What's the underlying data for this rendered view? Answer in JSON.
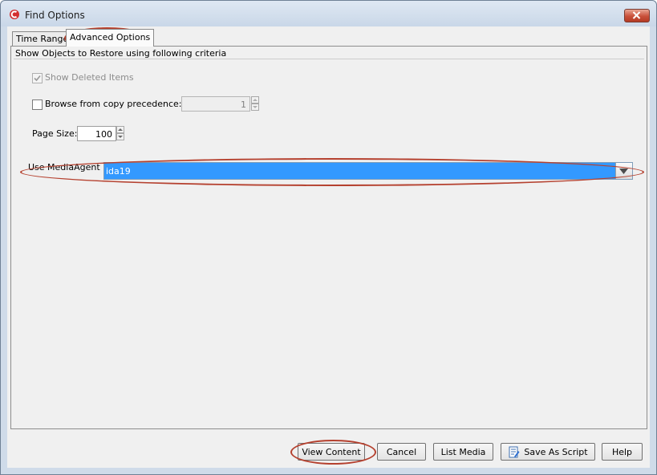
{
  "window": {
    "title": "Find Options",
    "app_icon": "commvault-logo-icon",
    "close_icon": "close-icon"
  },
  "tabs": [
    {
      "label": "Time Range",
      "selected": false
    },
    {
      "label": "Advanced Options",
      "selected": true
    }
  ],
  "criteria_group": {
    "title": "Show Objects to Restore using following criteria",
    "show_deleted": {
      "label": "Show Deleted Items",
      "checked": true,
      "enabled": false
    },
    "browse_copy": {
      "label": "Browse from copy precedence:",
      "checked": false,
      "value": "1",
      "enabled": false
    },
    "page_size": {
      "label": "Page Size:",
      "value": "100"
    },
    "media_agent": {
      "label": "Use MediaAgent",
      "selected_value": "ida19"
    }
  },
  "buttons": {
    "view_content": "View Content",
    "cancel": "Cancel",
    "list_media": "List Media",
    "save_as_script": "Save As Script",
    "help": "Help"
  },
  "colors": {
    "selection": "#3399ff",
    "annotation": "#b5412f"
  }
}
